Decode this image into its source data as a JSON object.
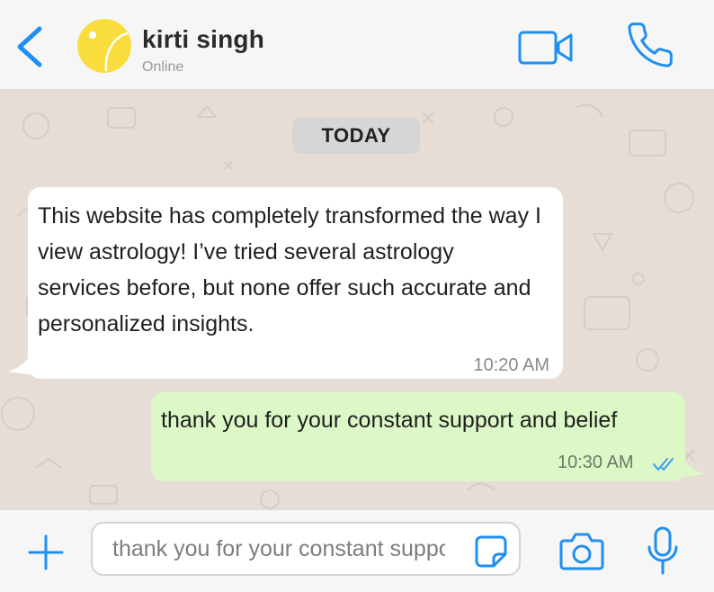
{
  "header": {
    "contact_name": "kirti singh",
    "contact_status": "Online",
    "icons": {
      "back": "chevron-left-icon",
      "video": "video-camera-icon",
      "call": "phone-icon"
    }
  },
  "chat": {
    "date_separator": "TODAY",
    "messages": [
      {
        "direction": "incoming",
        "text": "This website has completely transformed the way I view astrology! I’ve tried several astrology services before, but none offer such accurate and personalized insights.",
        "time": "10:20 AM"
      },
      {
        "direction": "outgoing",
        "text": "thank you for your constant support and belief",
        "time": "10:30 AM",
        "status": "read",
        "status_icon": "double-check-icon"
      }
    ]
  },
  "composer": {
    "input_value": "thank you for your constant support and belief",
    "icons": {
      "attach": "plus-icon",
      "sticker": "sticker-icon",
      "camera": "camera-icon",
      "mic": "microphone-icon"
    }
  },
  "colors": {
    "accent": "#1f8ff2",
    "incoming_bubble": "#ffffff",
    "outgoing_bubble": "#dbf8c6",
    "chat_background": "#e6ded6",
    "avatar": "#f9dd3d",
    "read_ticks": "#3c9df0"
  }
}
